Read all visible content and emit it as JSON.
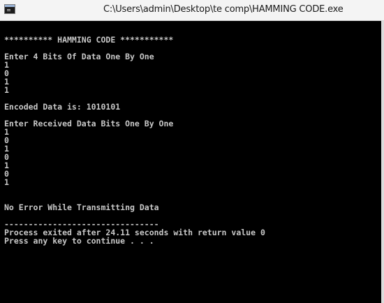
{
  "window": {
    "title": "C:\\Users\\admin\\Desktop\\te comp\\HAMMING CODE.exe",
    "icon": "console-app-icon"
  },
  "console": {
    "lines": [
      "",
      "********** HAMMING CODE ***********",
      "",
      "Enter 4 Bits Of Data One By One",
      "1",
      "0",
      "1",
      "1",
      "",
      "Encoded Data is: 1010101",
      "",
      "Enter Received Data Bits One By One",
      "1",
      "0",
      "1",
      "0",
      "1",
      "0",
      "1",
      "",
      "",
      "No Error While Transmitting Data",
      "",
      "--------------------------------",
      "Process exited after 24.11 seconds with return value 0",
      "Press any key to continue . . ."
    ]
  }
}
